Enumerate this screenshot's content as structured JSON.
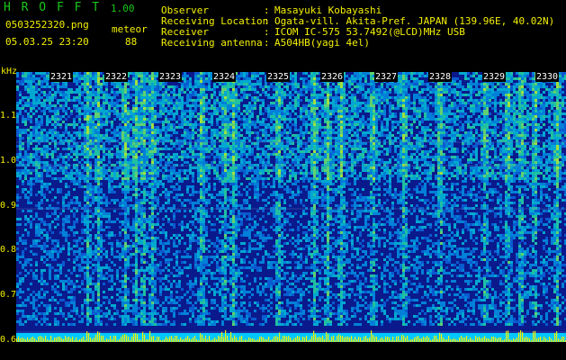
{
  "header": {
    "app_name": "H R O F F T",
    "version": "1.00",
    "filename": "0503252320.png",
    "datetime": "05.03.25 23:20",
    "meteor_label": "meteor",
    "meteor_count": "88"
  },
  "info": {
    "labels": [
      "Observer",
      "Receiving Location",
      "Receiver",
      "Receiving antenna"
    ],
    "colons": [
      ":",
      ":",
      ":",
      ":"
    ],
    "values": [
      "Masayuki Kobayashi",
      "Ogata-vill. Akita-Pref. JAPAN (139.96E, 40.02N)",
      "ICOM IC-575 53.7492(@LCD)MHz USB",
      "A504HB(yagi 4el)"
    ]
  },
  "axis": {
    "unit": "kHz",
    "ticks": [
      "1.1",
      "1.0",
      "0.9",
      "0.8",
      "0.7",
      "0.6"
    ]
  },
  "time_markers": [
    "2321",
    "2322",
    "2323",
    "2324",
    "2325",
    "2326",
    "2327",
    "2328",
    "2329",
    "2330"
  ],
  "colors": {
    "background": "#000000",
    "label_green": "#19c819",
    "text_yellow": "#f3f000",
    "spectrum_base": "#0a1a8c",
    "spectrum_noise": "#00a0c8",
    "baseline_bar": "#00c8ff"
  }
}
